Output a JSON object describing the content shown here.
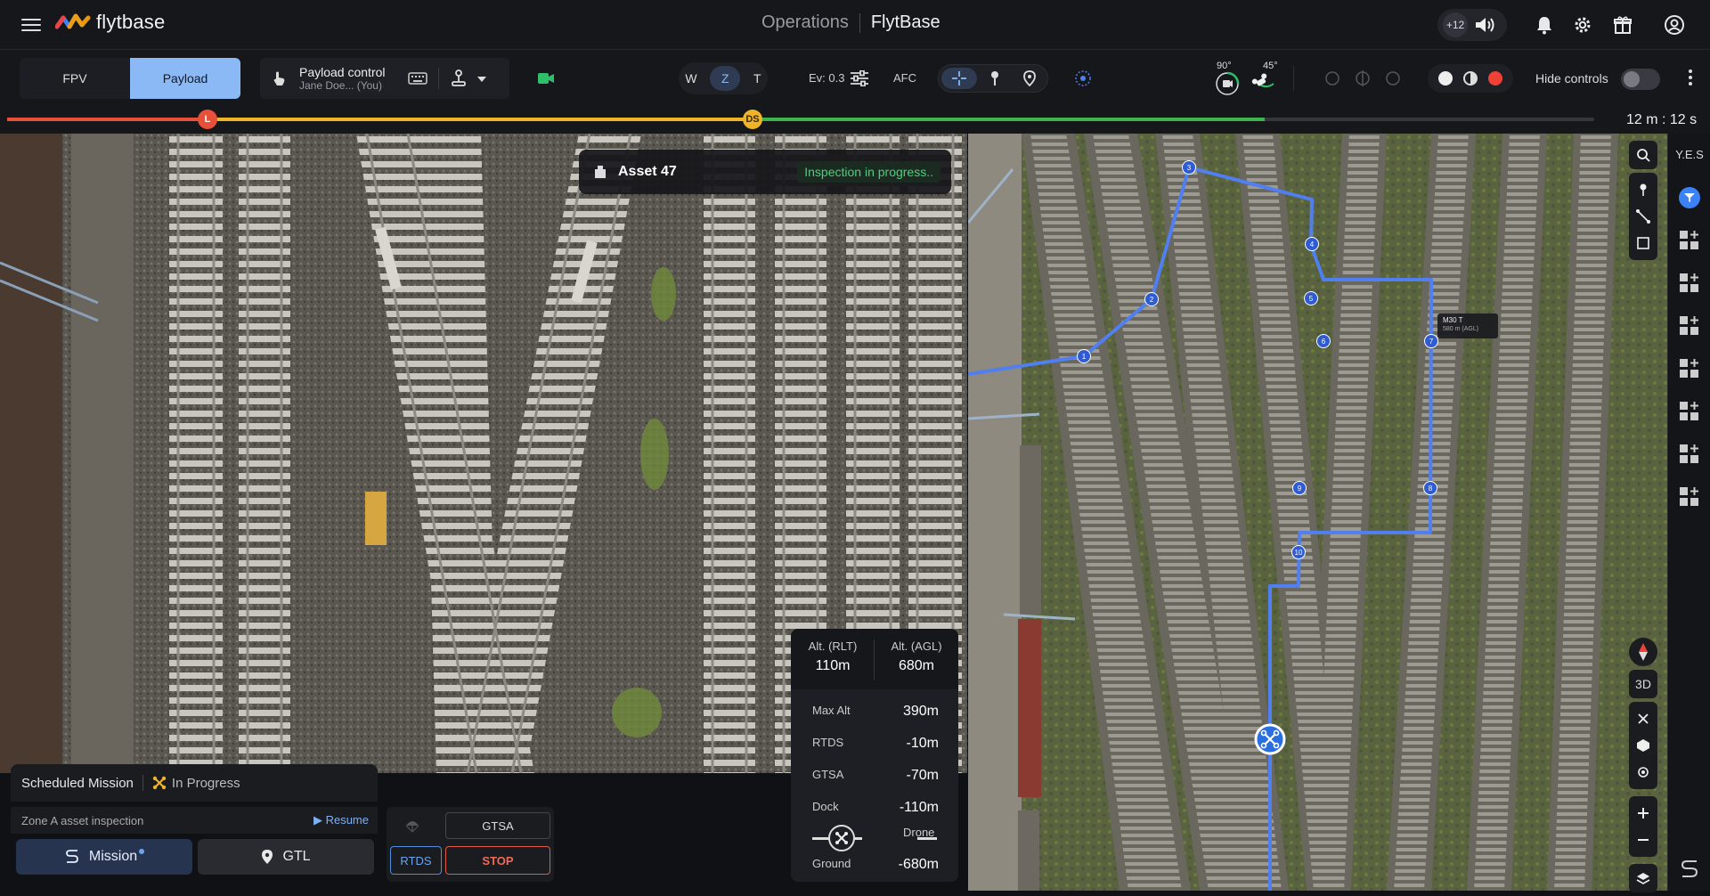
{
  "app": {
    "logo_text": "flytbase",
    "section": "Operations",
    "org": "FlytBase"
  },
  "header": {
    "notification_count": "+12"
  },
  "toolbar": {
    "view_tabs": [
      {
        "label": "FPV",
        "active": false
      },
      {
        "label": "Payload",
        "active": true
      }
    ],
    "payload_control": {
      "title": "Payload control",
      "user": "Jane Doe... (You)"
    },
    "zoom_modes": [
      "W",
      "Z",
      "T"
    ],
    "zoom_selected": "Z",
    "ev_label": "Ev: 0.3",
    "afc_label": "AFC",
    "gimbal_pitch": "90°",
    "gimbal_yaw": "45°",
    "hide_controls_label": "Hide controls",
    "hide_controls_on": false
  },
  "timeline": {
    "markers": [
      {
        "label": "L",
        "color": "#e8503a"
      },
      {
        "label": "DS",
        "color": "#f0b429"
      }
    ],
    "time": "12 m : 12 s",
    "segment_colors": {
      "red": "#e8503a",
      "yellow": "#f0b429",
      "green": "#3cb44b",
      "track": "#36373d"
    }
  },
  "asset": {
    "name": "Asset 47",
    "status": "Inspection in progress.."
  },
  "altitude": {
    "rlt_label": "Alt. (RLT)",
    "rlt_value": "110m",
    "agl_label": "Alt. (AGL)",
    "agl_value": "680m",
    "rows": [
      {
        "label": "Max Alt",
        "value": "390m"
      },
      {
        "label": "RTDS",
        "value": "-10m"
      },
      {
        "label": "GTSA",
        "value": "-70m"
      },
      {
        "label": "Dock",
        "value": "-110m"
      }
    ],
    "drone_label": "Drone",
    "ground_label": "Ground",
    "ground_value": "-680m"
  },
  "mission": {
    "type_label": "Scheduled Mission",
    "status": "In Progress",
    "name": "Zone A asset inspection",
    "resume_label": "Resume",
    "mission_button": "Mission",
    "gtl_button": "GTL",
    "gtsa_button": "GTSA",
    "rtds_button": "RTDS",
    "stop_button": "STOP"
  },
  "map": {
    "drone_tag_title": "M30 T",
    "drone_tag_sub": "580 m (AGL)",
    "waypoints": [
      "1",
      "2",
      "3",
      "4",
      "5",
      "6",
      "7",
      "8",
      "9",
      "10"
    ],
    "view_3d_label": "3D",
    "sidebar_label": "Y.E.S",
    "path_color": "#4f7ff0"
  }
}
